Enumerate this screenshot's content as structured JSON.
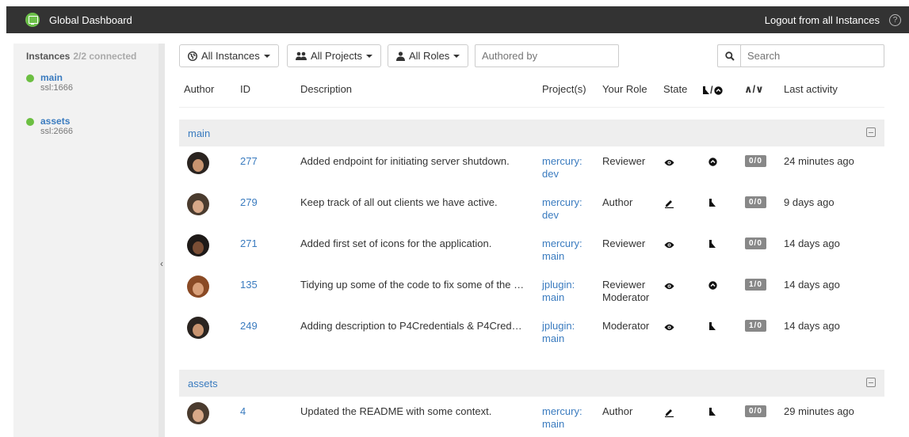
{
  "header": {
    "title": "Global Dashboard",
    "logout": "Logout from all Instances",
    "help": "?"
  },
  "sidebar": {
    "heading": "Instances",
    "connected": "2/2 connected",
    "instances": [
      {
        "name": "main",
        "port": "ssl:1666"
      },
      {
        "name": "assets",
        "port": "ssl:2666"
      }
    ]
  },
  "filters": {
    "instances": "All Instances",
    "projects": "All Projects",
    "roles": "All Roles",
    "authored_placeholder": "Authored by",
    "search_placeholder": "Search"
  },
  "columns": {
    "author": "Author",
    "id": "ID",
    "description": "Description",
    "projects": "Project(s)",
    "role": "Your Role",
    "state": "State",
    "votes": "∧/∨",
    "activity": "Last activity"
  },
  "groups": [
    {
      "name": "main",
      "rows": [
        {
          "id": "277",
          "description": "Added endpoint for initiating server shutdown.",
          "project1": "mercury:",
          "project2": "dev",
          "role1": "Reviewer",
          "role2": "",
          "state_icon": "eye-icon",
          "review_icon": "circle-up-icon",
          "votes": "0/0",
          "activity": "24 minutes ago",
          "skin": "#c89470",
          "hair": "#2a2420"
        },
        {
          "id": "279",
          "description": "Keep track of all out clients we have active.",
          "project1": "mercury:",
          "project2": "dev",
          "role1": "Author",
          "role2": "",
          "state_icon": "pencil-icon",
          "review_icon": "shoe-icon",
          "votes": "0/0",
          "activity": "9 days ago",
          "skin": "#d7a888",
          "hair": "#4a3b2e"
        },
        {
          "id": "271",
          "description": "Added first set of icons for the application.",
          "project1": "mercury:",
          "project2": "main",
          "role1": "Reviewer",
          "role2": "",
          "state_icon": "eye-icon",
          "review_icon": "shoe-icon",
          "votes": "0/0",
          "activity": "14 days ago",
          "skin": "#7a4e35",
          "hair": "#1e1a18"
        },
        {
          "id": "135",
          "description": "Tidying up some of the code to fix some of the ed...",
          "project1": "jplugin:",
          "project2": "main",
          "role1": "Reviewer",
          "role2": "Moderator",
          "state_icon": "eye-icon",
          "review_icon": "circle-up-icon",
          "votes": "1/0",
          "activity": "14 days ago",
          "skin": "#d9a07a",
          "hair": "#8a4a25"
        },
        {
          "id": "249",
          "description": "Adding description to P4Credentials & P4Credent...",
          "project1": "jplugin:",
          "project2": "main",
          "role1": "Moderator",
          "role2": "",
          "state_icon": "eye-icon",
          "review_icon": "shoe-icon",
          "votes": "1/0",
          "activity": "14 days ago",
          "skin": "#c89470",
          "hair": "#2a2420"
        }
      ]
    },
    {
      "name": "assets",
      "rows": [
        {
          "id": "4",
          "description": "Updated the README with some context.",
          "project1": "mercury:",
          "project2": "main",
          "role1": "Author",
          "role2": "",
          "state_icon": "pencil-icon",
          "review_icon": "shoe-icon",
          "votes": "0/0",
          "activity": "29 minutes ago",
          "skin": "#d7a888",
          "hair": "#4a3b2e"
        }
      ]
    }
  ]
}
